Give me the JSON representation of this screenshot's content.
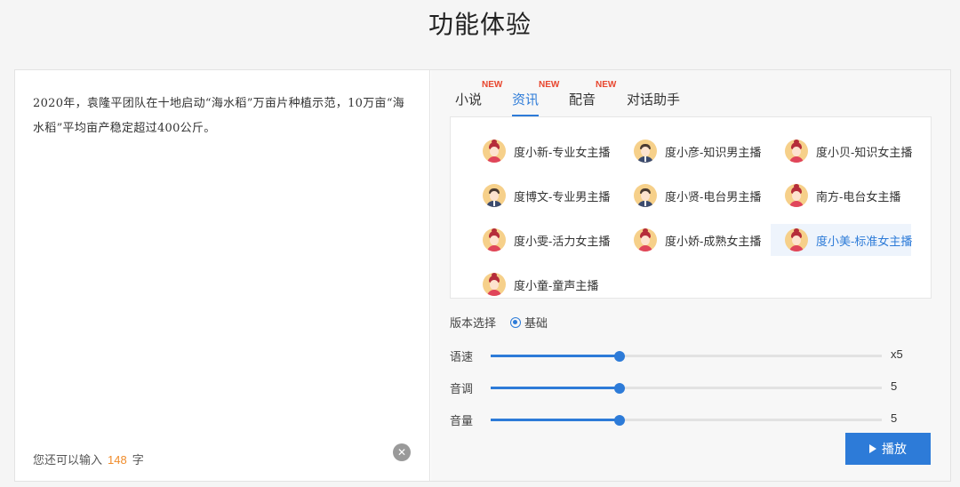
{
  "page": {
    "title": "功能体验"
  },
  "input": {
    "text": "2020年，袁隆平团队在十地启动“海水稻”万亩片种植示范，10万亩“海水稻”平均亩产稳定超过400公斤。",
    "remain_prefix": "您还可以输入",
    "remain_count": "148",
    "remain_suffix": "字",
    "clear_icon": "✕"
  },
  "tabs": [
    {
      "label": "小说",
      "badge": "NEW",
      "active": false
    },
    {
      "label": "资讯",
      "badge": "NEW",
      "active": true
    },
    {
      "label": "配音",
      "badge": "NEW",
      "active": false
    },
    {
      "label": "对话助手",
      "badge": "",
      "active": false
    }
  ],
  "voices": [
    {
      "name": "度小新-专业女主播",
      "gender": "female",
      "selected": false
    },
    {
      "name": "度小彦-知识男主播",
      "gender": "male",
      "selected": false
    },
    {
      "name": "度小贝-知识女主播",
      "gender": "female",
      "selected": false
    },
    {
      "name": "度博文-专业男主播",
      "gender": "male",
      "selected": false
    },
    {
      "name": "度小贤-电台男主播",
      "gender": "male",
      "selected": false
    },
    {
      "name": "南方-电台女主播",
      "gender": "female",
      "selected": false
    },
    {
      "name": "度小雯-活力女主播",
      "gender": "female",
      "selected": false
    },
    {
      "name": "度小娇-成熟女主播",
      "gender": "female",
      "selected": false
    },
    {
      "name": "度小美-标准女主播",
      "gender": "female",
      "selected": true
    },
    {
      "name": "度小童-童声主播",
      "gender": "female",
      "selected": false
    }
  ],
  "version": {
    "label": "版本选择",
    "option": "基础"
  },
  "sliders": [
    {
      "label": "语速",
      "value_text": "x5",
      "fraction": 0.33
    },
    {
      "label": "音调",
      "value_text": "5",
      "fraction": 0.33
    },
    {
      "label": "音量",
      "value_text": "5",
      "fraction": 0.33
    }
  ],
  "play_button": {
    "label": "播放"
  },
  "colors": {
    "accent": "#2d7bd8",
    "badge": "#e8462e",
    "count": "#f08c2b"
  }
}
